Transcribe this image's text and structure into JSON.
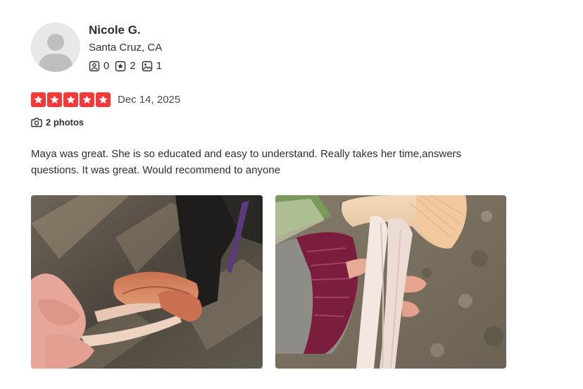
{
  "reviewer": {
    "name": "Nicole G.",
    "location": "Santa Cruz, CA",
    "stats": [
      {
        "icon": "friends-icon",
        "count": "0"
      },
      {
        "icon": "reviews-icon",
        "count": "2"
      },
      {
        "icon": "photos-icon",
        "count": "1"
      }
    ]
  },
  "review": {
    "rating": 5,
    "rating_max": 5,
    "star_color": "#f43939",
    "date": "Dec 14, 2025",
    "photo_count_label": "2 photos",
    "text": "Maya was great. She is so educated and easy to understand. Really takes her time,answers questions. It was great. Would recommend to anyone"
  },
  "photos": [
    {
      "subject": "hand holding orange mushrooms over forest floor"
    },
    {
      "subject": "hand in knit glove holding white-stemmed mushroom"
    }
  ]
}
